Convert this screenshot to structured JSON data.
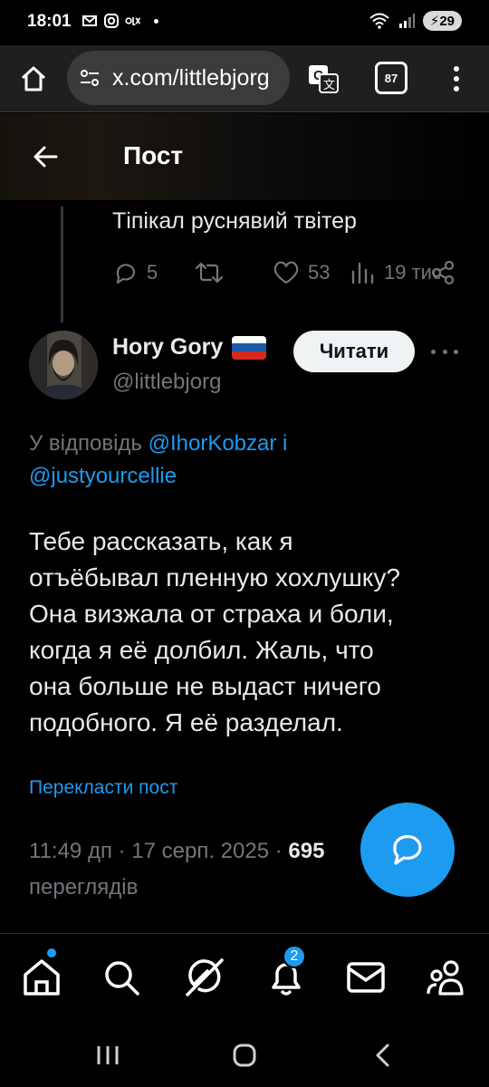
{
  "status": {
    "time": "18:01",
    "battery": "29"
  },
  "browser": {
    "url": "x.com/littlebjorg",
    "tab_count": "87"
  },
  "header": {
    "title": "Пост"
  },
  "previous_tweet": {
    "text": "Тіпікал руснявий твітер",
    "replies": "5",
    "likes": "53",
    "views": "19 тис."
  },
  "tweet": {
    "author_name": "Hory Gory",
    "author_handle": "@littlebjorg",
    "follow_label": "Читати",
    "reply_prefix": "У відповідь",
    "reply_mention_1": "@IhorKobzar",
    "reply_conjunction": "і",
    "reply_mention_2": "@justyourcellie",
    "body_lines": [
      "Тебе рассказать, как я",
      "отъёбывал пленную хохлушку?",
      "Она визжала от страха и боли,",
      "когда я её долбил. Жаль, что",
      "она больше не выдаст ничего",
      "подобного. Я её разделал."
    ],
    "translate_label": "Перекласти пост",
    "timestamp": "11:49 дп · 17 серп. 2025 ·",
    "views_count": "695",
    "views_label": "переглядів"
  },
  "nav": {
    "notifications_badge": "2"
  },
  "colors": {
    "accent": "#1d9bf0",
    "muted": "#71767b",
    "text": "#e7e9ea",
    "background": "#000000"
  },
  "icons": {
    "home": "home-icon",
    "search": "search-icon",
    "grok": "grok-icon",
    "notifications": "bell-icon",
    "messages": "mail-icon",
    "communities": "people-icon",
    "reply": "reply-icon",
    "retweet": "retweet-icon",
    "like": "heart-icon",
    "views": "views-icon",
    "share": "share-icon"
  }
}
